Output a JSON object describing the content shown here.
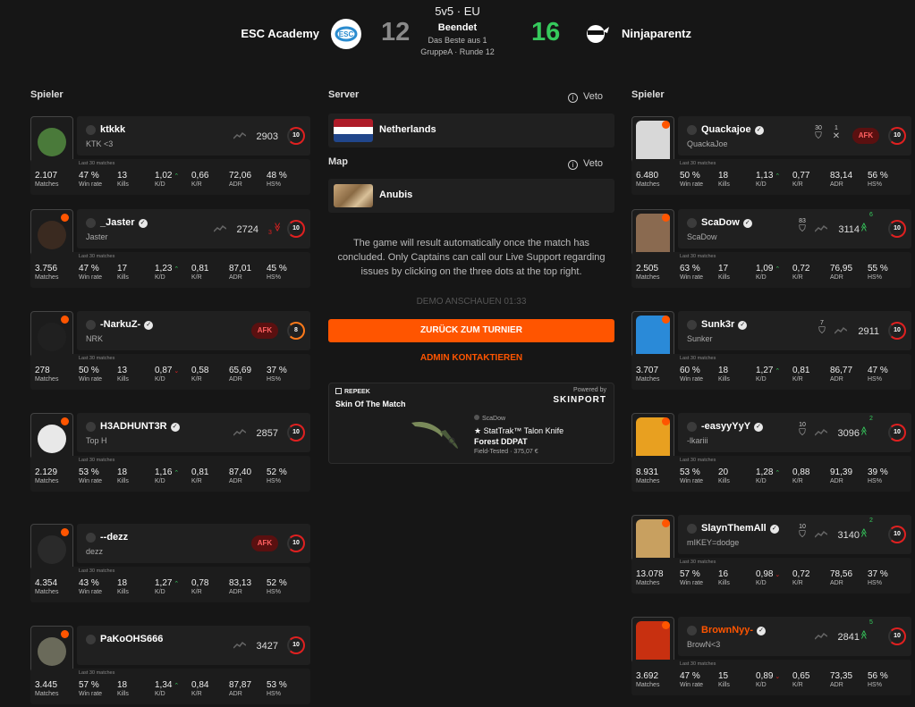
{
  "match": {
    "mode": "5v5 · EU",
    "status": "Beendet",
    "format": "Das Beste aus 1",
    "round": "GruppeA · Runde 12",
    "team1": {
      "name": "ESC Academy",
      "score": "12",
      "color": "#8a8a8a"
    },
    "team2": {
      "name": "Ninjaparentz",
      "score": "16",
      "color": "#36c95c"
    }
  },
  "labels": {
    "players": "Spieler",
    "server": "Server",
    "map": "Map",
    "veto": "Veto",
    "last30": "Last 30 matches",
    "matches": "Matches",
    "winrate": "Win rate",
    "kills": "Kills",
    "kd": "K/D",
    "kr": "K/R",
    "adr": "ADR",
    "hs": "HS%",
    "afk": "AFK"
  },
  "server": {
    "name": "Netherlands"
  },
  "map": {
    "name": "Anubis"
  },
  "notice": "The game will result automatically once the match has concluded. Only Captains can call our Live Support regarding issues by clicking on the three dots at the top right.",
  "demo": "DEMO ANSCHAUEN   01:33",
  "buttons": {
    "back": "ZURÜCK ZUM TURNIER",
    "admin": "ADMIN KONTAKTIEREN"
  },
  "skin": {
    "brand": "REPEEK",
    "title": "Skin Of The Match",
    "powered": "Powered by",
    "partner": "SKINPORT",
    "owner": "ScaDow",
    "item_line1": "★ StatTrak™ Talon Knife",
    "item_line2": "Forest DDPAT",
    "price": "Field-Tested · 375,07 €"
  },
  "team1_players": [
    {
      "name": "ktkkk",
      "sub": "KTK <3",
      "elo": "2903",
      "level": "10",
      "matches": "2.107",
      "winrate": "47 %",
      "kills": "13",
      "kd": "1,02",
      "kr": "0,66",
      "adr": "72,06",
      "hs": "48 %"
    },
    {
      "name": "_Jaster",
      "sub": "Jaster",
      "elo": "2724",
      "level": "10",
      "streak": "3",
      "matches": "3.756",
      "winrate": "47 %",
      "kills": "17",
      "kd": "1,23",
      "kr": "0,81",
      "adr": "87,01",
      "hs": "45 %"
    },
    {
      "name": "-NarkuZ-",
      "sub": "NRK",
      "elo": "",
      "level": "8",
      "matches": "278",
      "winrate": "50 %",
      "kills": "13",
      "kd": "0,87",
      "kr": "0,58",
      "adr": "65,69",
      "hs": "37 %"
    },
    {
      "name": "H3ADHUNT3R",
      "sub": "Top H",
      "elo": "2857",
      "level": "10",
      "matches": "2.129",
      "winrate": "53 %",
      "kills": "18",
      "kd": "1,16",
      "kr": "0,81",
      "adr": "87,40",
      "hs": "52 %"
    },
    {
      "name": "--dezz",
      "sub": "dezz",
      "elo": "",
      "level": "10",
      "matches": "4.354",
      "winrate": "43 %",
      "kills": "18",
      "kd": "1,27",
      "kr": "0,78",
      "adr": "83,13",
      "hs": "52 %"
    },
    {
      "name": "PaKoOHS666",
      "sub": "",
      "elo": "3427",
      "level": "10",
      "matches": "3.445",
      "winrate": "57 %",
      "kills": "18",
      "kd": "1,34",
      "kr": "0,84",
      "adr": "87,87",
      "hs": "53 %"
    }
  ],
  "team2_players": [
    {
      "name": "Quackajoe",
      "sub": "QuackaJoe",
      "medal1": "30",
      "medal2": "1",
      "level": "10",
      "matches": "6.480",
      "winrate": "50 %",
      "kills": "18",
      "kd": "1,13",
      "kr": "0,77",
      "adr": "83,14",
      "hs": "56 %"
    },
    {
      "name": "ScaDow",
      "sub": "ScaDow",
      "medal1": "83",
      "elo": "3114",
      "streak": "6",
      "level": "10",
      "matches": "2.505",
      "winrate": "63 %",
      "kills": "17",
      "kd": "1,09",
      "kr": "0,72",
      "adr": "76,95",
      "hs": "55 %"
    },
    {
      "name": "Sunk3r",
      "sub": "Sunker",
      "medal1": "7",
      "elo": "2911",
      "level": "10",
      "matches": "3.707",
      "winrate": "60 %",
      "kills": "18",
      "kd": "1,27",
      "kr": "0,81",
      "adr": "86,77",
      "hs": "47 %"
    },
    {
      "name": "-easyyYyY",
      "sub": "-lkariii",
      "medal1": "10",
      "elo": "3096",
      "streak": "2",
      "level": "10",
      "matches": "8.931",
      "winrate": "53 %",
      "kills": "20",
      "kd": "1,28",
      "kr": "0,88",
      "adr": "91,39",
      "hs": "39 %"
    },
    {
      "name": "SlaynThemAll",
      "sub": "mIKEY=dodge",
      "medal1": "10",
      "elo": "3140",
      "streak": "2",
      "level": "10",
      "matches": "13.078",
      "winrate": "57 %",
      "kills": "16",
      "kd": "0,98",
      "kr": "0,72",
      "adr": "78,56",
      "hs": "37 %"
    },
    {
      "name": "BrownNyy-",
      "sub": "BrowN<3",
      "elo": "2841",
      "streak": "5",
      "level": "10",
      "matches": "3.692",
      "winrate": "47 %",
      "kills": "15",
      "kd": "0,89",
      "kr": "0,65",
      "adr": "73,35",
      "hs": "56 %"
    }
  ]
}
